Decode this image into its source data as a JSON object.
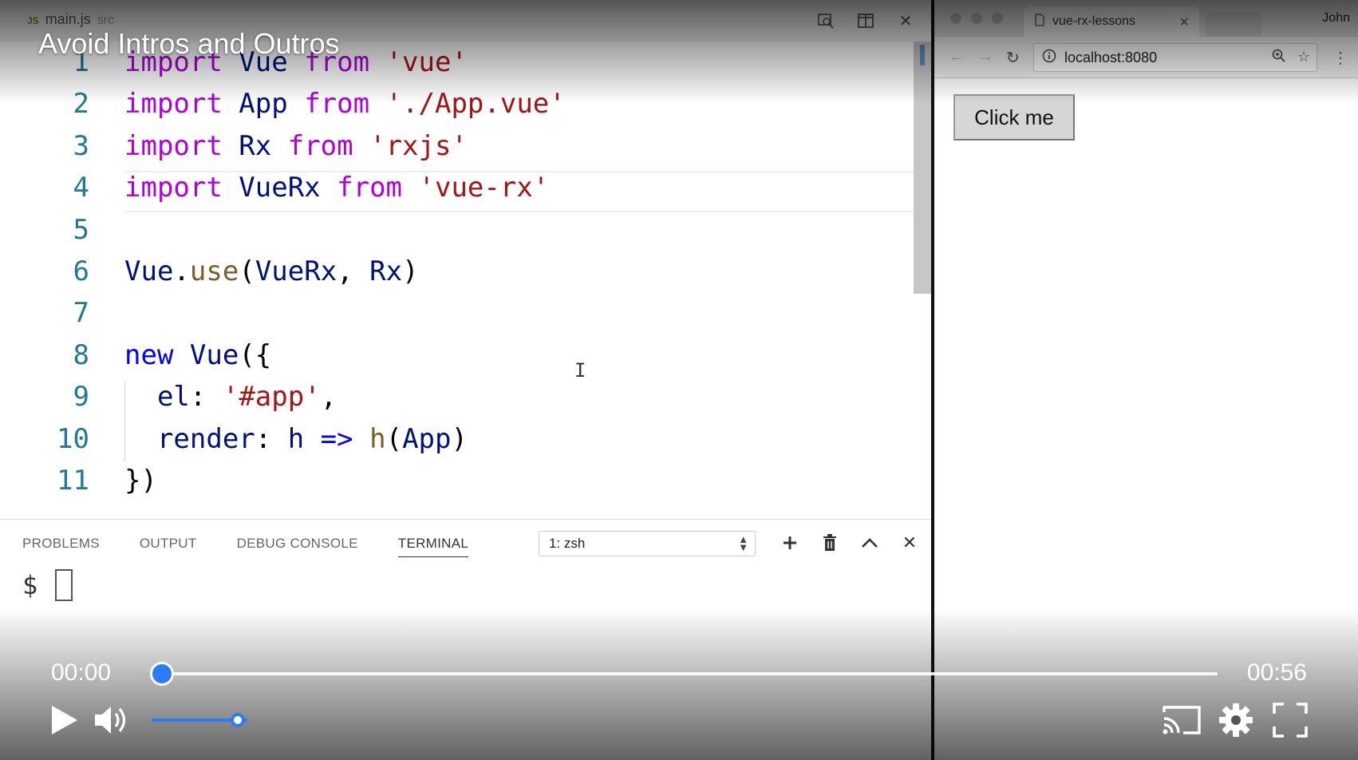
{
  "video": {
    "title": "Avoid Intros and Outros",
    "current_time": "00:00",
    "total_time": "00:56",
    "progress": 0.01,
    "volume": 0.9
  },
  "editor": {
    "file_badge": "JS",
    "file_name": "main.js",
    "file_dir": "src",
    "code_lines": [
      {
        "n": "1",
        "tokens": [
          {
            "t": "import",
            "c": "kw"
          },
          {
            "t": " Vue ",
            "c": "id"
          },
          {
            "t": "from",
            "c": "kw"
          },
          {
            "t": " ",
            "c": "plain"
          },
          {
            "t": "'vue'",
            "c": "str"
          }
        ]
      },
      {
        "n": "2",
        "tokens": [
          {
            "t": "import",
            "c": "kw"
          },
          {
            "t": " App ",
            "c": "id"
          },
          {
            "t": "from",
            "c": "kw"
          },
          {
            "t": " ",
            "c": "plain"
          },
          {
            "t": "'./App.vue'",
            "c": "str"
          }
        ]
      },
      {
        "n": "3",
        "tokens": [
          {
            "t": "import",
            "c": "kw"
          },
          {
            "t": " Rx ",
            "c": "id"
          },
          {
            "t": "from",
            "c": "kw"
          },
          {
            "t": " ",
            "c": "plain"
          },
          {
            "t": "'rxjs'",
            "c": "str"
          }
        ]
      },
      {
        "n": "4",
        "tokens": [
          {
            "t": "import",
            "c": "kw"
          },
          {
            "t": " VueRx ",
            "c": "id"
          },
          {
            "t": "from",
            "c": "kw"
          },
          {
            "t": " ",
            "c": "plain"
          },
          {
            "t": "'vue-rx'",
            "c": "str"
          }
        ]
      },
      {
        "n": "5",
        "tokens": []
      },
      {
        "n": "6",
        "tokens": [
          {
            "t": "Vue",
            "c": "id"
          },
          {
            "t": ".",
            "c": "plain"
          },
          {
            "t": "use",
            "c": "fn"
          },
          {
            "t": "(",
            "c": "plain"
          },
          {
            "t": "VueRx",
            "c": "id"
          },
          {
            "t": ", ",
            "c": "plain"
          },
          {
            "t": "Rx",
            "c": "id"
          },
          {
            "t": ")",
            "c": "plain"
          }
        ]
      },
      {
        "n": "7",
        "tokens": []
      },
      {
        "n": "8",
        "tokens": [
          {
            "t": "new",
            "c": "kw2"
          },
          {
            "t": " ",
            "c": "plain"
          },
          {
            "t": "Vue",
            "c": "id"
          },
          {
            "t": "({",
            "c": "plain"
          }
        ]
      },
      {
        "n": "9",
        "tokens": [
          {
            "t": "  el",
            "c": "id"
          },
          {
            "t": ": ",
            "c": "plain"
          },
          {
            "t": "'#app'",
            "c": "str"
          },
          {
            "t": ",",
            "c": "plain"
          }
        ]
      },
      {
        "n": "10",
        "tokens": [
          {
            "t": "  render",
            "c": "id"
          },
          {
            "t": ": ",
            "c": "plain"
          },
          {
            "t": "h",
            "c": "id"
          },
          {
            "t": " => ",
            "c": "kw2"
          },
          {
            "t": "h",
            "c": "fn"
          },
          {
            "t": "(",
            "c": "plain"
          },
          {
            "t": "App",
            "c": "id"
          },
          {
            "t": ")",
            "c": "plain"
          }
        ]
      },
      {
        "n": "11",
        "tokens": [
          {
            "t": "})",
            "c": "plain"
          }
        ]
      }
    ]
  },
  "panel": {
    "tabs": [
      "PROBLEMS",
      "OUTPUT",
      "DEBUG CONSOLE",
      "TERMINAL"
    ],
    "active_tab": "TERMINAL",
    "terminal_select": "1: zsh",
    "prompt": "$"
  },
  "browser": {
    "tab_title": "vue-rx-lessons",
    "user": "John",
    "url": "localhost:8080",
    "page_button": "Click me"
  },
  "colors": {
    "accent": "#2b7cf6",
    "keyword": "#af00db",
    "string": "#a31515",
    "line_number": "#237893"
  }
}
